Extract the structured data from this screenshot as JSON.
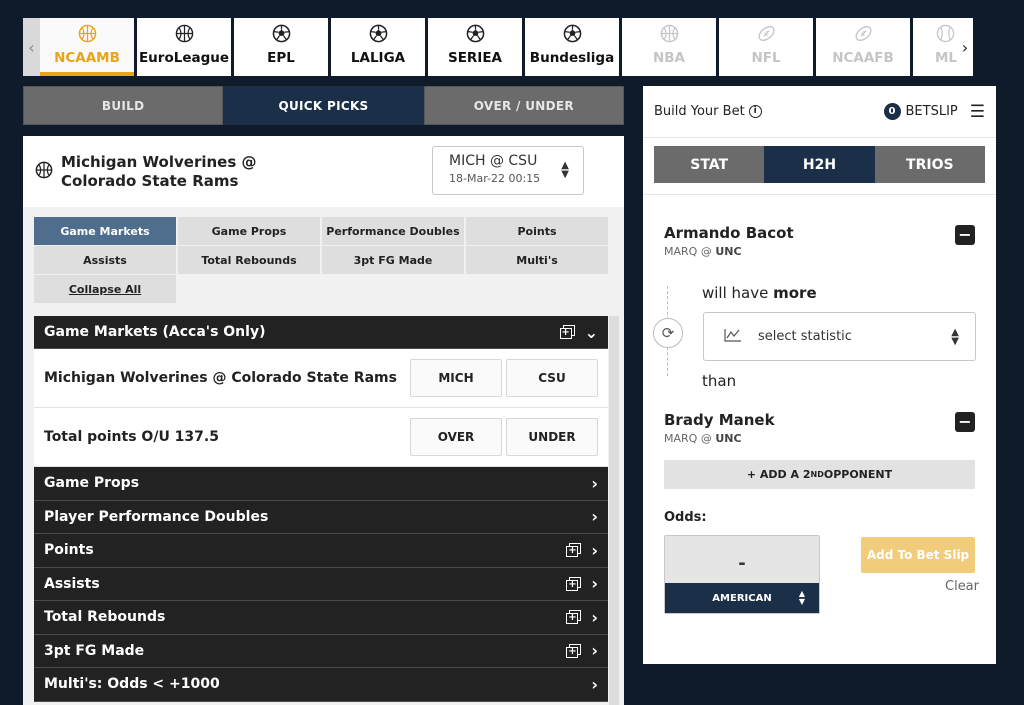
{
  "sports": [
    {
      "label": "NCAAMB",
      "icon": "basketball-icon",
      "state": "active"
    },
    {
      "label": "EuroLeague",
      "icon": "basketball-icon",
      "state": "normal"
    },
    {
      "label": "EPL",
      "icon": "soccer-ball-icon",
      "state": "normal"
    },
    {
      "label": "LALIGA",
      "icon": "soccer-ball-icon",
      "state": "normal"
    },
    {
      "label": "SERIEA",
      "icon": "soccer-ball-icon",
      "state": "normal"
    },
    {
      "label": "Bundesliga",
      "icon": "soccer-ball-icon",
      "state": "normal"
    },
    {
      "label": "NBA",
      "icon": "basketball-icon",
      "state": "dim"
    },
    {
      "label": "NFL",
      "icon": "football-icon",
      "state": "dim"
    },
    {
      "label": "NCAAFB",
      "icon": "football-icon",
      "state": "dim"
    },
    {
      "label": "MLB",
      "icon": "baseball-icon",
      "state": "dim"
    }
  ],
  "mode_tabs": [
    "BUILD",
    "QUICK PICKS",
    "OVER / UNDER"
  ],
  "match": {
    "title": "Michigan Wolverines @ Colorado State Rams",
    "select_value": "MICH @ CSU",
    "select_date": "18-Mar-22 00:15"
  },
  "markets": [
    "Game Markets",
    "Game Props",
    "Performance Doubles",
    "Points",
    "Assists",
    "Total Rebounds",
    "3pt FG Made",
    "Multi's",
    "Collapse All"
  ],
  "game_markets": {
    "header": "Game Markets (Acca's Only)",
    "rows": [
      {
        "label": "Michigan Wolverines @ Colorado State Rams",
        "btn1": "MICH",
        "btn2": "CSU"
      },
      {
        "label": "Total points O/U 137.5",
        "btn1": "OVER",
        "btn2": "UNDER"
      }
    ]
  },
  "collapsed_sections": [
    {
      "label": "Game Props",
      "multi": false
    },
    {
      "label": "Player Performance Doubles",
      "multi": false
    },
    {
      "label": "Points",
      "multi": true
    },
    {
      "label": "Assists",
      "multi": true
    },
    {
      "label": "Total Rebounds",
      "multi": true
    },
    {
      "label": "3pt FG Made",
      "multi": true
    },
    {
      "label": "Multi's: Odds < +1000",
      "multi": false
    }
  ],
  "right": {
    "title": "Build Your Bet",
    "betslip_count": "0",
    "betslip_label": "BETSLIP",
    "type_tabs": [
      "STAT",
      "H2H",
      "TRIOS"
    ],
    "player1": {
      "name": "Armando Bacot",
      "match_prefix": "MARQ @ ",
      "match_team": "UNC"
    },
    "will_have": "will have ",
    "will_have_bold": "more",
    "stat_placeholder": "select statistic",
    "than": "than",
    "player2": {
      "name": "Brady Manek",
      "match_prefix": "MARQ @ ",
      "match_team": "UNC"
    },
    "add_opponent_pre": "+ ADD A 2",
    "add_opponent_sup": "ND",
    "add_opponent_post": " OPPONENT",
    "odds_label": "Odds:",
    "odds_value": "-",
    "odds_format": "AMERICAN",
    "add_to_slip": "Add To Bet Slip",
    "clear": "Clear"
  },
  "colors": {
    "accent": "#e8a317",
    "navy": "#1b2f48",
    "add_slip": "#f1cc7a"
  }
}
